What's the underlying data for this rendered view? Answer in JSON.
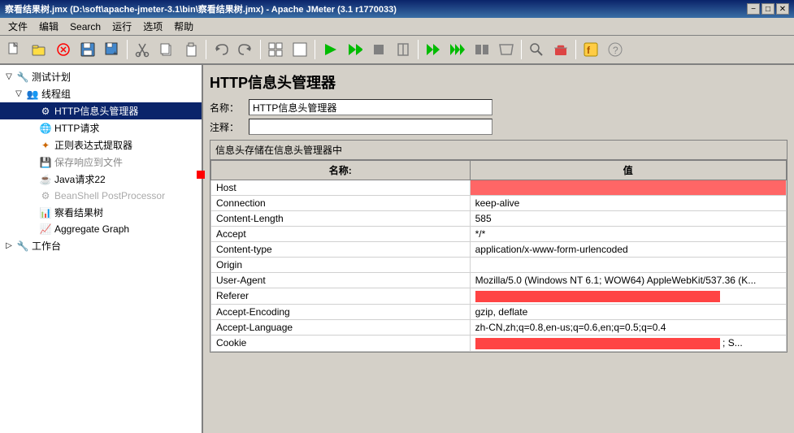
{
  "titleBar": {
    "text": "察看结果树.jmx (D:\\soft\\apache-jmeter-3.1\\bin\\察看结果树.jmx) - Apache JMeter (3.1 r1770033)",
    "minBtn": "−",
    "maxBtn": "□",
    "closeBtn": "✕"
  },
  "menuBar": {
    "items": [
      "文件",
      "编辑",
      "Search",
      "运行",
      "选项",
      "帮助"
    ]
  },
  "toolbar": {
    "buttons": [
      {
        "name": "new-btn",
        "icon": "📄"
      },
      {
        "name": "open-btn",
        "icon": "📂"
      },
      {
        "name": "close-btn",
        "icon": "🚫"
      },
      {
        "name": "save-btn",
        "icon": "💾"
      },
      {
        "name": "saveas-btn",
        "icon": "📋"
      },
      {
        "name": "cut-btn",
        "icon": "✂"
      },
      {
        "name": "copy-btn",
        "icon": "📑"
      },
      {
        "name": "paste-btn",
        "icon": "📌"
      },
      {
        "name": "undo-btn",
        "icon": "↩"
      },
      {
        "name": "redo-btn",
        "icon": "↪"
      },
      {
        "name": "expand-btn",
        "icon": "⊞"
      },
      {
        "name": "collapse-btn",
        "icon": "⊟"
      },
      {
        "name": "clear-btn",
        "icon": "⊘"
      },
      {
        "name": "run-btn",
        "icon": "▶"
      },
      {
        "name": "run-start-btn",
        "icon": "▷"
      },
      {
        "name": "stop-btn",
        "icon": "⬛"
      },
      {
        "name": "stop2-btn",
        "icon": "⏹"
      },
      {
        "name": "remote-run-btn",
        "icon": "▶▶"
      },
      {
        "name": "search-btn",
        "icon": "🔍"
      }
    ]
  },
  "tree": {
    "items": [
      {
        "id": "test-plan",
        "label": "测试计划",
        "level": 0,
        "expanded": true,
        "icon": "📋",
        "hasExpand": true,
        "expandChar": "▽"
      },
      {
        "id": "thread-group",
        "label": "线程组",
        "level": 1,
        "expanded": true,
        "icon": "👥",
        "hasExpand": true,
        "expandChar": "▽"
      },
      {
        "id": "http-header",
        "label": "HTTP信息头管理器",
        "level": 2,
        "expanded": false,
        "icon": "⚙",
        "selected": true
      },
      {
        "id": "http-request",
        "label": "HTTP请求",
        "level": 2,
        "expanded": false,
        "icon": "🌐"
      },
      {
        "id": "regex-extractor",
        "label": "正则表达式提取器",
        "level": 2,
        "expanded": false,
        "icon": "✦"
      },
      {
        "id": "save-response",
        "label": "保存响应到文件",
        "level": 2,
        "expanded": false,
        "icon": "💾"
      },
      {
        "id": "java-request",
        "label": "Java请求22",
        "level": 2,
        "expanded": false,
        "icon": "☕"
      },
      {
        "id": "beanshell",
        "label": "BeanShell PostProcessor",
        "level": 2,
        "expanded": false,
        "icon": "⚙",
        "disabled": true
      },
      {
        "id": "view-results",
        "label": "察看结果树",
        "level": 2,
        "expanded": false,
        "icon": "📊"
      },
      {
        "id": "aggregate-graph",
        "label": "Aggregate Graph",
        "level": 2,
        "expanded": false,
        "icon": "📈"
      },
      {
        "id": "workbench",
        "label": "工作台",
        "level": 0,
        "expanded": false,
        "icon": "🔧",
        "hasExpand": true,
        "expandChar": "▷"
      }
    ]
  },
  "rightPanel": {
    "title": "HTTP信息头管理器",
    "nameLabel": "名称：",
    "nameValue": "HTTP信息头管理器",
    "commentLabel": "注释：",
    "commentValue": "",
    "tableTitle": "信息头存储在信息头管理器中",
    "tableHeaders": [
      "名称:",
      "值"
    ],
    "tableRows": [
      {
        "name": "Host",
        "value": "",
        "valueStyle": "red"
      },
      {
        "name": "Connection",
        "value": "keep-alive",
        "valueStyle": "normal"
      },
      {
        "name": "Content-Length",
        "value": "585",
        "valueStyle": "normal"
      },
      {
        "name": "Accept",
        "value": "*/*",
        "valueStyle": "normal"
      },
      {
        "name": "Content-type",
        "value": "application/x-www-form-urlencoded",
        "valueStyle": "normal"
      },
      {
        "name": "Origin",
        "value": "",
        "valueStyle": "normal"
      },
      {
        "name": "User-Agent",
        "value": "Mozilla/5.0 (Windows NT 6.1; WOW64) AppleWebKit/537.36 (K...",
        "valueStyle": "normal"
      },
      {
        "name": "Referer",
        "value": "",
        "valueStyle": "redbar"
      },
      {
        "name": "Accept-Encoding",
        "value": "gzip, deflate",
        "valueStyle": "normal"
      },
      {
        "name": "Accept-Language",
        "value": "zh-CN,zh;q=0.8,en-us;q=0.6,en;q=0.5;q=0.4",
        "valueStyle": "normal"
      },
      {
        "name": "Cookie",
        "value": "; S...",
        "valueStyle": "redbar"
      }
    ]
  }
}
